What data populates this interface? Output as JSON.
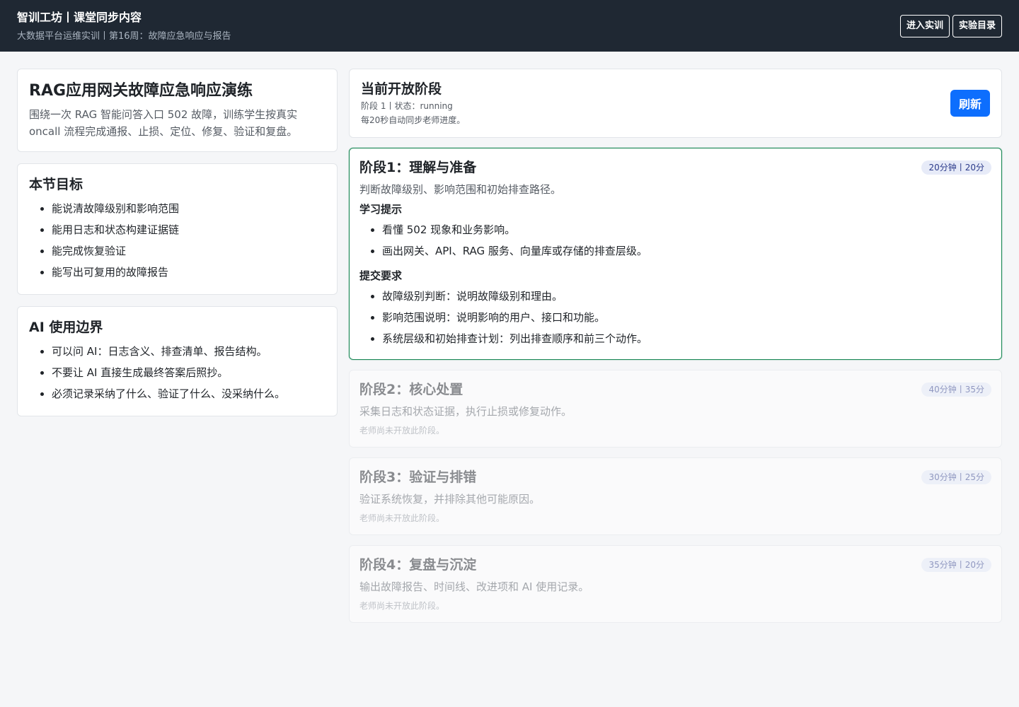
{
  "header": {
    "brand": "智训工坊丨课堂同步内容",
    "breadcrumb": "大数据平台运维实训丨第16周：故障应急响应与报告",
    "enter_lab_label": "进入实训",
    "lab_catalog_label": "实验目录"
  },
  "intro": {
    "title": "RAG应用网关故障应急响应演练",
    "description": "围绕一次 RAG 智能问答入口 502 故障，训练学生按真实 oncall 流程完成通报、止损、定位、修复、验证和复盘。"
  },
  "objectives": {
    "title": "本节目标",
    "items": [
      "能说清故障级别和影响范围",
      "能用日志和状态构建证据链",
      "能完成恢复验证",
      "能写出可复用的故障报告"
    ]
  },
  "ai_boundary": {
    "title": "AI 使用边界",
    "items": [
      "可以问 AI：日志含义、排查清单、报告结构。",
      "不要让 AI 直接生成最终答案后照抄。",
      "必须记录采纳了什么、验证了什么、没采纳什么。"
    ]
  },
  "status": {
    "title": "当前开放阶段",
    "line1": "阶段 1丨状态：running",
    "line2": "每20秒自动同步老师进度。",
    "refresh_label": "刷新"
  },
  "phases": [
    {
      "title": "阶段1：理解与准备",
      "badge": "20分钟丨20分",
      "description": "判断故障级别、影响范围和初始排查路径。",
      "tips_title": "学习提示",
      "tips": [
        "看懂 502 现象和业务影响。",
        "画出网关、API、RAG 服务、向量库或存储的排查层级。"
      ],
      "req_title": "提交要求",
      "requirements": [
        "故障级别判断：说明故障级别和理由。",
        "影响范围说明：说明影响的用户、接口和功能。",
        "系统层级和初始排查计划：列出排查顺序和前三个动作。"
      ]
    },
    {
      "title": "阶段2：核心处置",
      "badge": "40分钟丨35分",
      "description": "采集日志和状态证据，执行止损或修复动作。",
      "note": "老师尚未开放此阶段。"
    },
    {
      "title": "阶段3：验证与排错",
      "badge": "30分钟丨25分",
      "description": "验证系统恢复，并排除其他可能原因。",
      "note": "老师尚未开放此阶段。"
    },
    {
      "title": "阶段4：复盘与沉淀",
      "badge": "35分钟丨20分",
      "description": "输出故障报告、时间线、改进项和 AI 使用记录。",
      "note": "老师尚未开放此阶段。"
    }
  ]
}
